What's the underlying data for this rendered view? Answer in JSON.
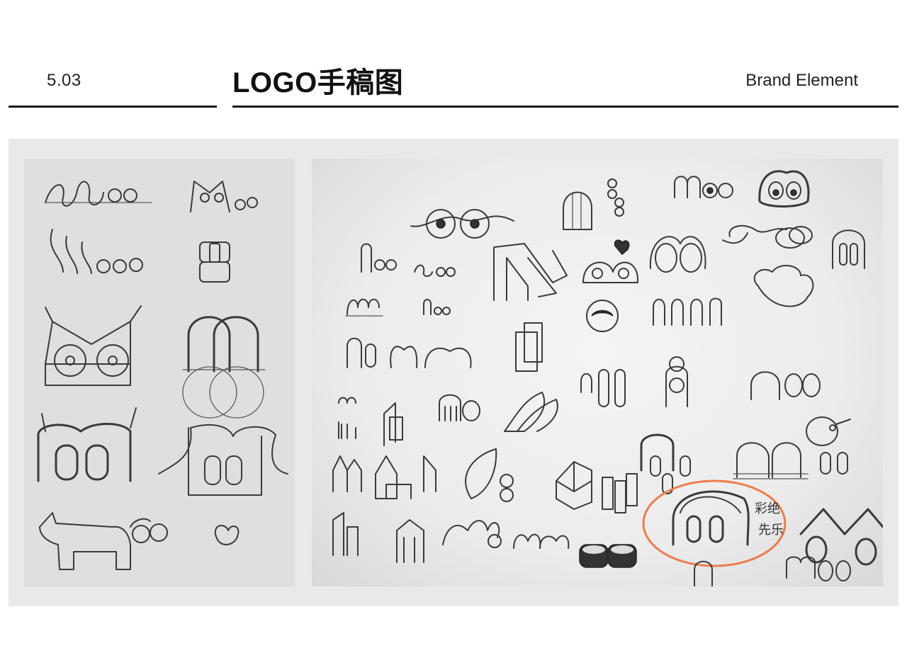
{
  "header": {
    "section_number": "5.03",
    "title": "LOGO手稿图",
    "brand_label": "Brand Element"
  },
  "sketches": {
    "handwritten_note_line1": "彩绝",
    "handwritten_note_line2": "先乐",
    "highlight_color": "#ef7c4a"
  }
}
